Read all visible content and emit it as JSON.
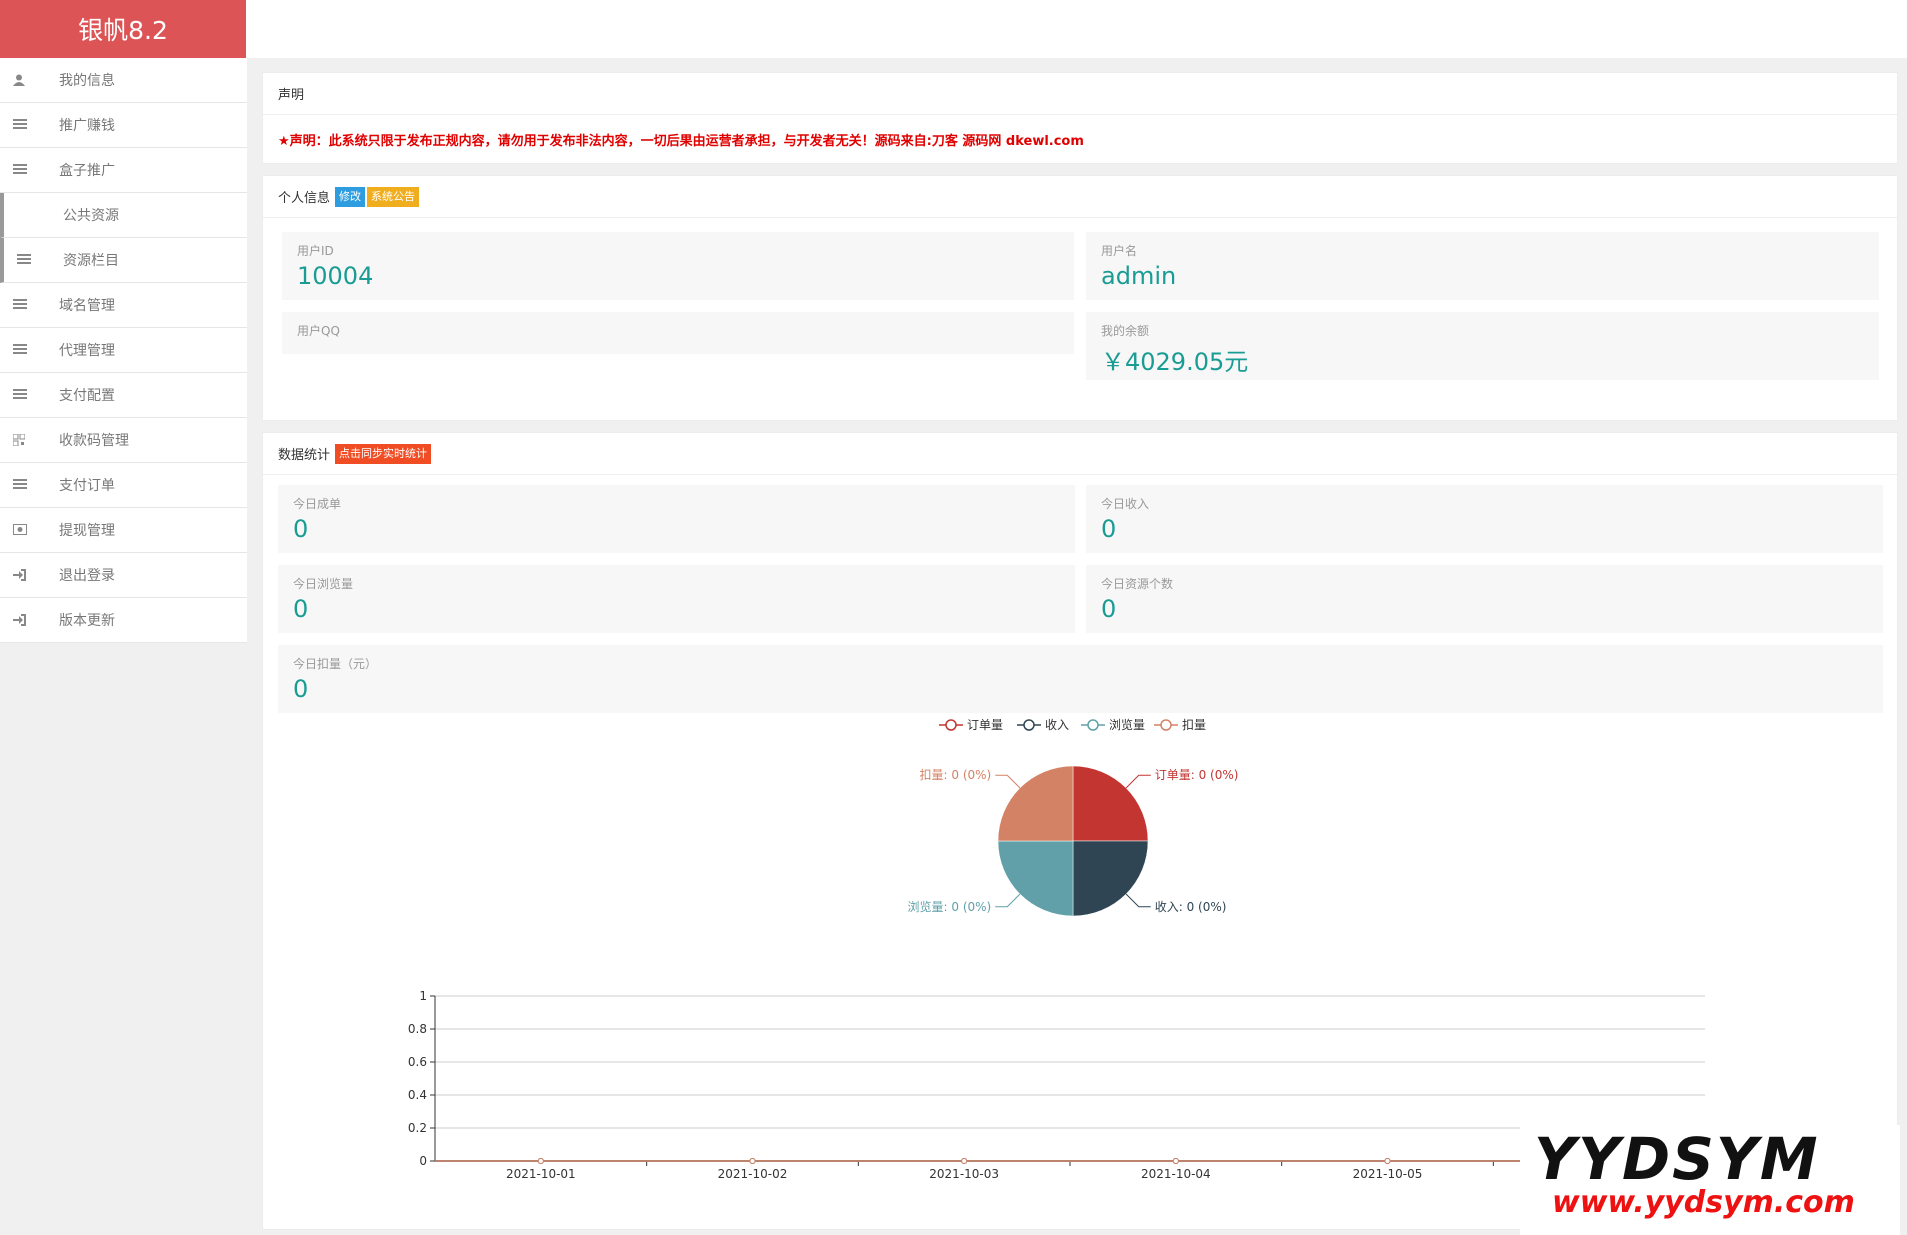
{
  "app": {
    "logo": "银帆8.2"
  },
  "sidebar": {
    "items": [
      {
        "label": "我的信息",
        "icon": "user-icon"
      },
      {
        "label": "推广赚钱",
        "icon": "list-icon"
      },
      {
        "label": "盒子推广",
        "icon": "list-icon"
      },
      {
        "label": "公共资源",
        "icon": ""
      },
      {
        "label": "资源栏目",
        "icon": "list-icon"
      },
      {
        "label": "域名管理",
        "icon": "list-icon"
      },
      {
        "label": "代理管理",
        "icon": "list-icon"
      },
      {
        "label": "支付配置",
        "icon": "list-icon"
      },
      {
        "label": "收款码管理",
        "icon": "qrcode-icon"
      },
      {
        "label": "支付订单",
        "icon": "list-icon"
      },
      {
        "label": "提现管理",
        "icon": "money-icon"
      },
      {
        "label": "退出登录",
        "icon": "sign-in-icon"
      },
      {
        "label": "版本更新",
        "icon": "sign-in-icon"
      }
    ]
  },
  "notice": {
    "title": "声明",
    "text": "★声明：此系统只限于发布正规内容，请勿用于发布非法内容，一切后果由运营者承担，与开发者无关！源码来自:刀客 源码网 dkewl.com"
  },
  "profile": {
    "title": "个人信息",
    "edit_label": "修改",
    "announce_label": "系统公告",
    "user_id_caption": "用户ID",
    "user_id": "10004",
    "username_caption": "用户名",
    "username": "admin",
    "qq_caption": "用户QQ",
    "qq": "",
    "balance_caption": "我的余额",
    "balance": "￥4029.05元"
  },
  "stats": {
    "title": "数据统计",
    "sync_label": "点击同步实时统计",
    "today_orders_caption": "今日成单",
    "today_orders": "0",
    "today_income_caption": "今日收入",
    "today_income": "0",
    "today_views_caption": "今日浏览量",
    "today_views": "0",
    "today_resources_caption": "今日资源个数",
    "today_resources": "0",
    "today_deduct_caption": "今日扣量（元）",
    "today_deduct": "0"
  },
  "chart_data": [
    {
      "type": "pie",
      "legend": [
        "订单量",
        "收入",
        "浏览量",
        "扣量"
      ],
      "colors": [
        "#c23531",
        "#2f4554",
        "#61a0a8",
        "#d48265"
      ],
      "values": [
        0,
        0,
        0,
        0
      ],
      "labels": [
        "订单量: 0 (0%)",
        "收入: 0 (0%)",
        "浏览量: 0 (0%)",
        "扣量: 0 (0%)"
      ]
    },
    {
      "type": "line",
      "categories": [
        "2021-10-01",
        "2021-10-02",
        "2021-10-03",
        "2021-10-04",
        "2021-10-05"
      ],
      "series": [
        {
          "name": "订单量",
          "values": [
            0,
            0,
            0,
            0,
            0
          ]
        },
        {
          "name": "收入",
          "values": [
            0,
            0,
            0,
            0,
            0
          ]
        },
        {
          "name": "浏览量",
          "values": [
            0,
            0,
            0,
            0,
            0
          ]
        },
        {
          "name": "扣量",
          "values": [
            0,
            0,
            0,
            0,
            0
          ]
        }
      ],
      "yticks": [
        "0",
        "0.2",
        "0.4",
        "0.6",
        "0.8",
        "1"
      ],
      "ylim": [
        0,
        1
      ]
    }
  ],
  "watermark": {
    "big": "YYDSYM",
    "small": "www.yydsym.com"
  }
}
